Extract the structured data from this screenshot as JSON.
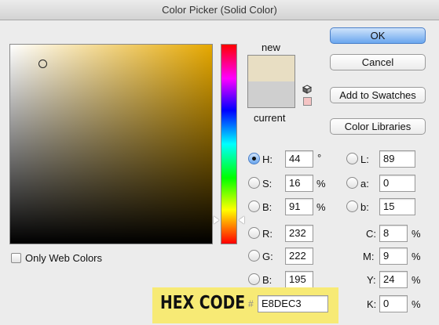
{
  "window": {
    "title": "Color Picker (Solid Color)"
  },
  "colors": {
    "new_color": "#e8dec3",
    "current_color": "#cfcfcf",
    "web_swatch": "#f5c4c4",
    "highlight_banner": "#f7ea75",
    "field_hue": "#e6a800"
  },
  "preview": {
    "new_label": "new",
    "current_label": "current"
  },
  "buttons": {
    "ok": "OK",
    "cancel": "Cancel",
    "add_to_swatches": "Add to Swatches",
    "color_libraries": "Color Libraries"
  },
  "hsb": {
    "h": {
      "label": "H:",
      "value": "44",
      "unit": "°",
      "selected": true
    },
    "s": {
      "label": "S:",
      "value": "16",
      "unit": "%"
    },
    "b": {
      "label": "B:",
      "value": "91",
      "unit": "%"
    }
  },
  "rgb": {
    "r": {
      "label": "R:",
      "value": "232"
    },
    "g": {
      "label": "G:",
      "value": "222"
    },
    "b": {
      "label": "B:",
      "value": "195"
    }
  },
  "lab": {
    "l": {
      "label": "L:",
      "value": "89"
    },
    "a": {
      "label": "a:",
      "value": "0"
    },
    "b": {
      "label": "b:",
      "value": "15"
    }
  },
  "cmyk": {
    "c": {
      "label": "C:",
      "value": "8",
      "unit": "%"
    },
    "m": {
      "label": "M:",
      "value": "9",
      "unit": "%"
    },
    "y": {
      "label": "Y:",
      "value": "24",
      "unit": "%"
    },
    "k": {
      "label": "K:",
      "value": "0",
      "unit": "%"
    }
  },
  "options": {
    "only_web_colors": "Only Web Colors"
  },
  "hex": {
    "banner_title": "HEX CODE",
    "hash": "#",
    "value": "E8DEC3"
  },
  "icons": {
    "out_of_gamut": "cube-icon"
  }
}
